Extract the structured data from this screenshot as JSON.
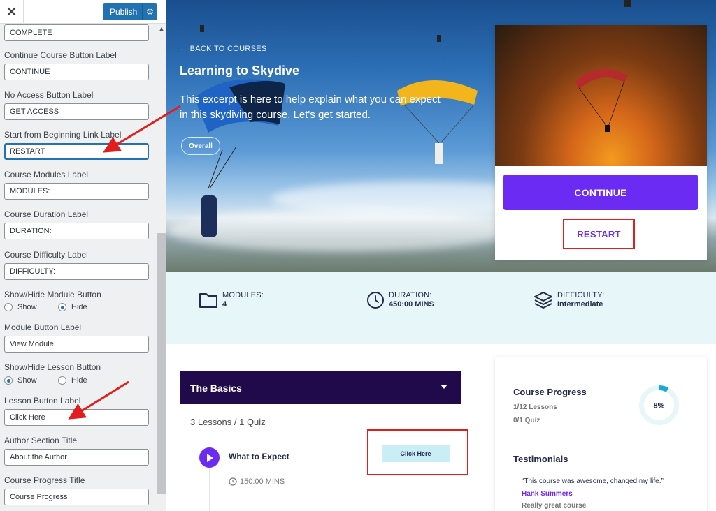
{
  "customizer": {
    "close_icon": "close-icon",
    "publish_label": "Publish",
    "publish_gear_icon": "gear-icon",
    "fields": [
      {
        "label": "",
        "value": "COMPLETE"
      },
      {
        "label": "Continue Course Button Label",
        "value": "CONTINUE"
      },
      {
        "label": "No Access Button Label",
        "value": "GET ACCESS"
      },
      {
        "label": "Start from Beginning Link Label",
        "value": "RESTART"
      },
      {
        "label": "Course Modules Label",
        "value": "MODULES:"
      },
      {
        "label": "Course Duration Label",
        "value": "DURATION:"
      },
      {
        "label": "Course Difficulty Label",
        "value": "DIFFICULTY:"
      }
    ],
    "module_toggle": {
      "label": "Show/Hide Module Button",
      "show": "Show",
      "hide": "Hide",
      "selected": "Hide"
    },
    "module_button_label": {
      "label": "Module Button Label",
      "value": "View Module"
    },
    "lesson_toggle": {
      "label": "Show/Hide Lesson Button",
      "show": "Show",
      "hide": "Hide",
      "selected": "Show"
    },
    "lesson_button_label": {
      "label": "Lesson Button Label",
      "value": "Click Here"
    },
    "author_title": {
      "label": "Author Section Title",
      "value": "About the Author"
    },
    "progress_title": {
      "label": "Course Progress Title",
      "value": "Course Progress"
    }
  },
  "hero": {
    "back_link": "BACK TO COURSES",
    "title": "Learning to Skydive",
    "excerpt": "This excerpt is here to help explain what you can expect in this skydiving course. Let's get started.",
    "overall_badge": "Overall"
  },
  "course_card": {
    "continue_label": "CONTINUE",
    "restart_label": "RESTART"
  },
  "meta": {
    "modules": {
      "label": "MODULES:",
      "value": "4",
      "icon": "folder-icon"
    },
    "duration": {
      "label": "DURATION:",
      "value": "450:00 MINS",
      "icon": "clock-icon"
    },
    "difficulty": {
      "label": "DIFFICULTY:",
      "value": "Intermediate",
      "icon": "layers-icon"
    }
  },
  "module": {
    "title": "The Basics",
    "count": "3 Lessons / 1 Quiz",
    "lesson": {
      "title": "What to Expect",
      "duration": "150:00 MINS",
      "button": "Click Here"
    }
  },
  "sidebar": {
    "progress_title": "Course Progress",
    "lessons": "1/12 Lessons",
    "quiz": "0/1 Quiz",
    "percent_label": "8%",
    "percent": 8,
    "testimonials_title": "Testimonials",
    "quote": "“This course was awesome, changed my life.”",
    "author": "Hank Summers",
    "caption": "Really great course"
  },
  "colors": {
    "accent_purple": "#6b2bf2",
    "module_header": "#210a4b",
    "annotation_red": "#e01e1e",
    "wp_blue": "#2271b1"
  }
}
